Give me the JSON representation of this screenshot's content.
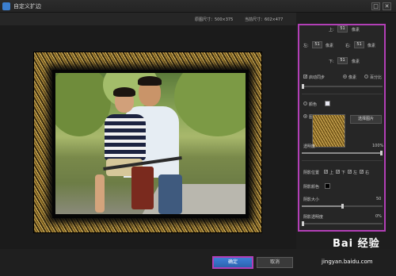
{
  "window": {
    "title": "自定义扩边",
    "buttons": {
      "restore": "□",
      "close": "✕"
    }
  },
  "info": {
    "original_size": "原图尺寸：500×375",
    "current_size": "当前尺寸：602×477"
  },
  "panel": {
    "top_label": "上:",
    "top_value": "51",
    "top_unit": "像素",
    "left_label": "左:",
    "left_value": "51",
    "left_unit": "像素",
    "right_label": "右:",
    "right_value": "51",
    "right_unit": "像素",
    "bottom_label": "下:",
    "bottom_value": "51",
    "bottom_unit": "像素",
    "auto_sync": "启动同步",
    "unit_pixel": "像素",
    "unit_percent": "百分比",
    "color_label": "颜色",
    "pattern_label": "图案",
    "select_image": "选择图片",
    "opacity_label": "透明度",
    "opacity_value": "100%",
    "shadow_position": "阴影位置",
    "pos_top": "上",
    "pos_bottom": "下",
    "pos_left": "左",
    "pos_right": "右",
    "shadow_color": "阴影颜色",
    "shadow_size": "阴影大小",
    "shadow_size_value": "50",
    "shadow_opacity": "阴影透明度",
    "shadow_opacity_value": "0%"
  },
  "footer": {
    "ok": "确定",
    "cancel": "取消"
  },
  "watermark": {
    "logo": "Bai 经验",
    "url": "jingyan.baidu.com"
  },
  "colors": {
    "highlight": "#b23fb6",
    "ok_button": "#3d7fd6",
    "color_swatch": "#e8e8f2",
    "shadow_swatch": "#000000"
  },
  "levels": {
    "top_slider": 0.0,
    "opacity": 1.0,
    "shadow_size": 0.5,
    "shadow_opacity": 0.0
  }
}
